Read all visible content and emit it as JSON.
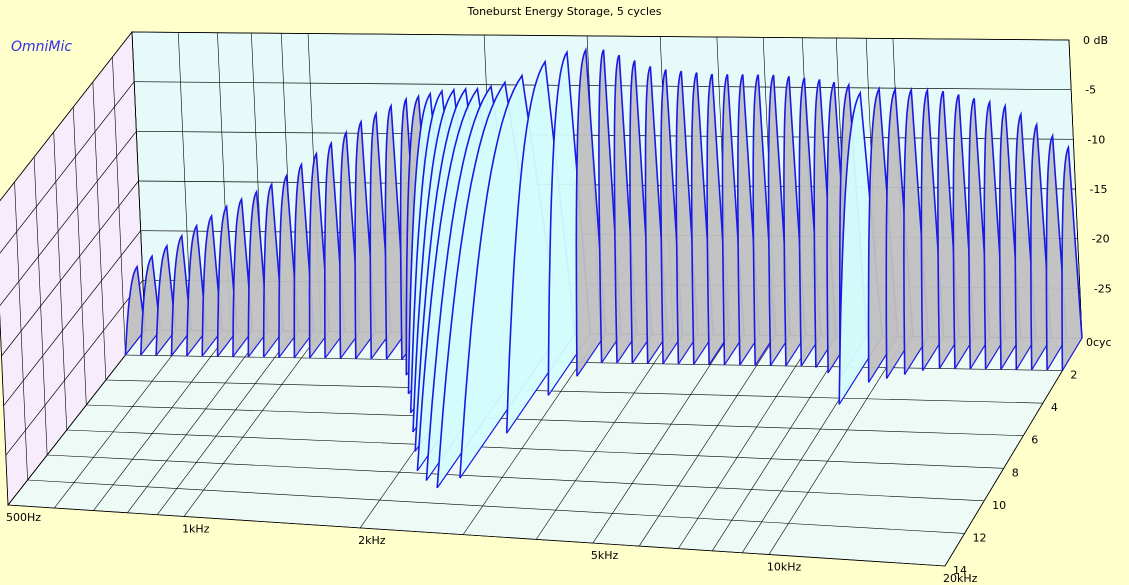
{
  "brand": "OmniMic",
  "colors": {
    "background": "#ffffcc",
    "floor": "#eefaf6",
    "back_wall": "#e6fafa",
    "side_wall": "#f6ecfb",
    "grid": "#000000",
    "slice_stroke": "#1a1ae6",
    "slice_fill": "#c0c0c0",
    "slice_fill_light": "#d4fcfc"
  },
  "chart_data": {
    "type": "waterfall-3d",
    "title": "Toneburst Energy Storage, 5 cycles",
    "x_axis": {
      "scale": "log",
      "range_hz": [
        500,
        20000
      ],
      "labeled_ticks": [
        {
          "value": 500,
          "label": "500Hz"
        },
        {
          "value": 1000,
          "label": "1kHz"
        },
        {
          "value": 2000,
          "label": "2kHz"
        },
        {
          "value": 5000,
          "label": "5kHz"
        },
        {
          "value": 10000,
          "label": "10kHz"
        },
        {
          "value": 20000,
          "label": "20kHz"
        }
      ]
    },
    "z_axis": {
      "unit": "dB",
      "range": [
        -30,
        0
      ],
      "labeled_ticks": [
        {
          "value": 0,
          "label": "0 dB"
        },
        {
          "value": -5,
          "label": "-5"
        },
        {
          "value": -10,
          "label": "-10"
        },
        {
          "value": -15,
          "label": "-15"
        },
        {
          "value": -20,
          "label": "-20"
        },
        {
          "value": -25,
          "label": "-25"
        }
      ]
    },
    "time_axis": {
      "unit": "cycles",
      "range": [
        0,
        14
      ],
      "labeled_ticks": [
        {
          "value": 0,
          "label": "0cyc"
        },
        {
          "value": 2,
          "label": "2"
        },
        {
          "value": 4,
          "label": "4"
        },
        {
          "value": 6,
          "label": "6"
        },
        {
          "value": 8,
          "label": "8"
        },
        {
          "value": 10,
          "label": "10"
        },
        {
          "value": 12,
          "label": "12"
        },
        {
          "value": 14,
          "label": "14"
        }
      ]
    },
    "slices": {
      "count": 62,
      "peak_level_db": [
        [
          500,
          -23
        ],
        [
          560,
          -21
        ],
        [
          630,
          -19
        ],
        [
          710,
          -17
        ],
        [
          800,
          -15.5
        ],
        [
          900,
          -14
        ],
        [
          1000,
          -12
        ],
        [
          1120,
          -10
        ],
        [
          1250,
          -8
        ],
        [
          1400,
          -6.5
        ],
        [
          1600,
          -5
        ],
        [
          1800,
          -3.5
        ],
        [
          2000,
          -2.5
        ],
        [
          2250,
          -1.5
        ],
        [
          2500,
          -0.5
        ],
        [
          2800,
          0
        ],
        [
          3200,
          -0.5
        ],
        [
          3600,
          -1.5
        ],
        [
          4000,
          -2.5
        ],
        [
          5000,
          -3
        ],
        [
          6300,
          -3
        ],
        [
          8000,
          -3.5
        ],
        [
          10000,
          -4
        ],
        [
          12500,
          -4.5
        ],
        [
          16000,
          -6
        ],
        [
          18000,
          -8
        ],
        [
          20000,
          -10
        ]
      ],
      "decay_cycles": [
        [
          500,
          2
        ],
        [
          1500,
          2
        ],
        [
          2150,
          10
        ],
        [
          2400,
          11
        ],
        [
          2600,
          10
        ],
        [
          2800,
          5
        ],
        [
          3200,
          2
        ],
        [
          7500,
          2
        ],
        [
          9000,
          3
        ],
        [
          9200,
          5.5
        ],
        [
          9600,
          3
        ],
        [
          12000,
          2
        ],
        [
          20000,
          2
        ]
      ]
    }
  }
}
